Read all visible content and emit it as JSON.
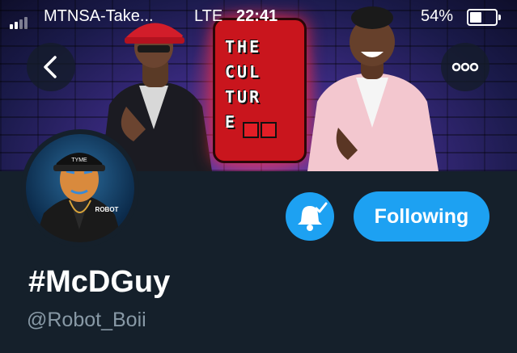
{
  "status_bar": {
    "carrier": "MTNSA-Take...",
    "network": "LTE",
    "time": "22:41",
    "battery_percent": "54%",
    "battery_level": 0.54,
    "signal_bars_filled": 2
  },
  "header": {
    "back_icon": "chevron-left-icon",
    "more_icon": "more-horizontal-icon",
    "banner_logo_lines": [
      "THE",
      "CUL",
      "TUR",
      "E"
    ]
  },
  "profile": {
    "display_name": "#McDGuy",
    "handle": "@Robot_Boii",
    "following_label": "Following",
    "notification_icon": "bell-check-icon",
    "avatar_caption": "ROBOT"
  },
  "colors": {
    "background": "#15202b",
    "accent": "#1da1f2",
    "handle_text": "#8899a6"
  }
}
